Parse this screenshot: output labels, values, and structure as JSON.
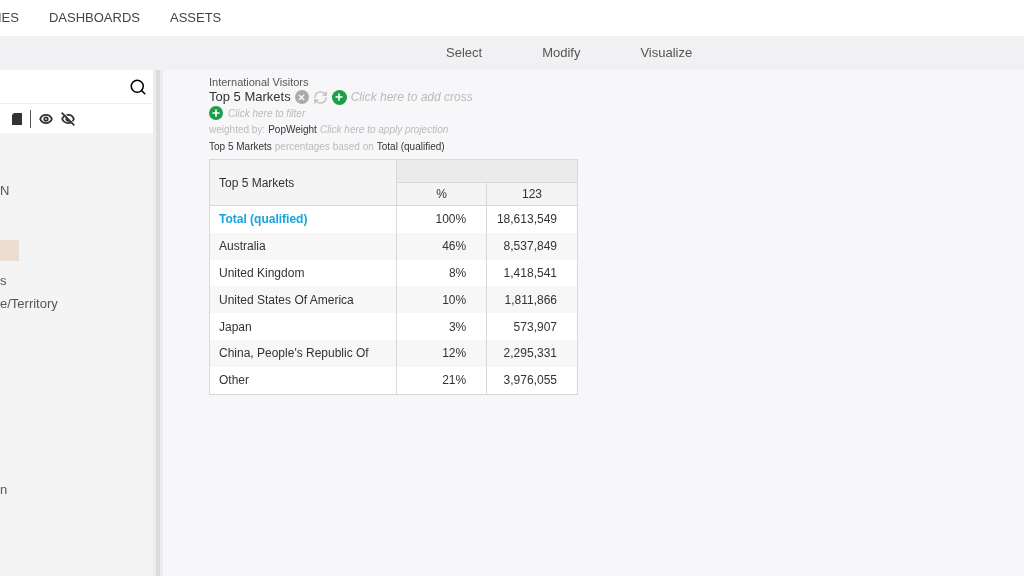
{
  "nav": [
    "IES",
    "DASHBOARDS",
    "ASSETS"
  ],
  "toolbar_tabs": [
    "Select",
    "Modify",
    "Visualize"
  ],
  "sidebar": {
    "items": [
      {
        "label": "N",
        "selected": false
      },
      {
        "selected": true
      },
      {
        "label": "s",
        "selected": false
      },
      {
        "label": "e/Territory",
        "selected": false
      },
      {
        "label": "n",
        "selected": false
      }
    ]
  },
  "report": {
    "dataset": "International Visitors",
    "row_variable": "Top 5 Markets",
    "add_cross_hint": "Click here to add cross",
    "filter_hint": "Click here to filter",
    "weighted_label": "weighted by:",
    "weight": "PopWeight",
    "projection_hint": "Click here to apply projection",
    "base_variable": "Top 5 Markets",
    "base_text": "percentages based on",
    "base": "Total (qualified)"
  },
  "table": {
    "corner": "Top 5 Markets",
    "columns": [
      "%",
      "123"
    ],
    "rows": [
      {
        "kind": "total",
        "label": "Total (qualified)",
        "cells": [
          "100%",
          "18,613,549"
        ]
      },
      {
        "kind": "category",
        "label": "Australia",
        "cells": [
          "46%",
          "8,537,849"
        ]
      },
      {
        "kind": "category",
        "label": "United Kingdom",
        "cells": [
          "8%",
          "1,418,541"
        ]
      },
      {
        "kind": "category",
        "label": "United States Of America",
        "cells": [
          "10%",
          "1,811,866"
        ]
      },
      {
        "kind": "category",
        "label": "Japan",
        "cells": [
          "3%",
          "573,907"
        ]
      },
      {
        "kind": "category",
        "label": "China, People's Republic Of",
        "cells": [
          "12%",
          "2,295,331"
        ]
      },
      {
        "kind": "category",
        "label": "Other",
        "cells": [
          "21%",
          "3,976,055"
        ]
      }
    ]
  }
}
